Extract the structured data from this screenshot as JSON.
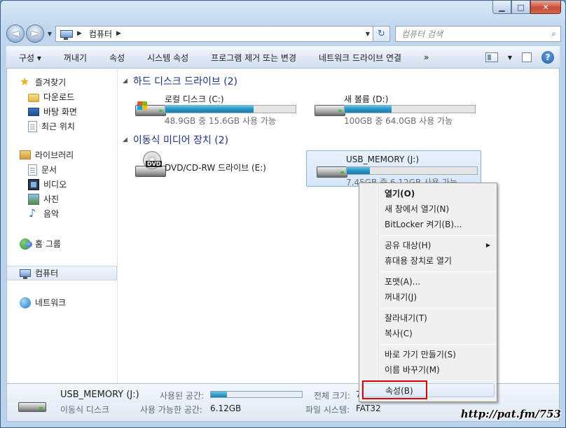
{
  "window": {
    "controls": {
      "minimize": "▁",
      "maximize": "□",
      "close": "✕"
    }
  },
  "nav": {
    "back": "◄",
    "forward": "►",
    "history": "▼"
  },
  "address": {
    "root_arrow": "▶",
    "segment": "컴퓨터",
    "seg_arrow": "▶",
    "dropdown": "▼",
    "refresh": "↻"
  },
  "search": {
    "placeholder": "컴퓨터 검색",
    "icon": "search-icon"
  },
  "toolbar": {
    "items": [
      "구성 ▾",
      "꺼내기",
      "속성",
      "시스템 속성",
      "프로그램 제거 또는 변경",
      "네트워크 드라이브 연결",
      "»"
    ],
    "view_dropdown": "▼",
    "help": "?"
  },
  "sidebar": {
    "favorites": {
      "label": "즐겨찾기",
      "items": [
        "다운로드",
        "바탕 화면",
        "최근 위치"
      ]
    },
    "libraries": {
      "label": "라이브러리",
      "items": [
        "문서",
        "비디오",
        "사진",
        "음악"
      ]
    },
    "homegroup": "홈 그룹",
    "computer": "컴퓨터",
    "network": "네트워크"
  },
  "sections": {
    "hdd": "하드 디스크 드라이브 (2)",
    "removable": "이동식 미디어 장치 (2)"
  },
  "drives": [
    {
      "name": "로컬 디스크 (C:)",
      "info": "48.9GB 중 15.6GB 사용 가능",
      "used_fraction": 0.68
    },
    {
      "name": "새 볼륨 (D:)",
      "info": "100GB 중 64.0GB 사용 가능",
      "used_fraction": 0.36
    },
    {
      "name": "DVD/CD-RW 드라이브 (E:)",
      "badge": "DVD"
    },
    {
      "name": "USB_MEMORY (J:)",
      "info": "7.45GB 중 6.12GB 사용 가능",
      "used_fraction": 0.18
    }
  ],
  "details": {
    "name": "USB_MEMORY (J:)",
    "type": "이동식 디스크",
    "used_label": "사용된 공간:",
    "free_label": "사용 가능한 공간:",
    "free_value": "6.12GB",
    "total_label": "전체 크기:",
    "total_value": "7",
    "fs_label": "파일 시스템:",
    "fs_value": "FAT32",
    "used_fraction": 0.18
  },
  "context_menu": {
    "items": [
      "열기(O)",
      "새 창에서 열기(N)",
      "BitLocker 켜기(B)...",
      "공유 대상(H)",
      "휴대용 장치로 열기",
      "포맷(A)...",
      "꺼내기(J)",
      "잘라내기(T)",
      "복사(C)",
      "바로 가기 만들기(S)",
      "이름 바꾸기(M)",
      "속성(B)"
    ],
    "submenu_arrow": "▶"
  },
  "watermark": "http://pat.fm/753"
}
